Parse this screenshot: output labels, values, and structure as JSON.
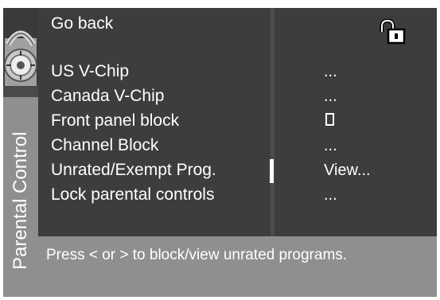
{
  "sidebar": {
    "title": "Parental Control"
  },
  "menu": {
    "go_back": "Go back",
    "items": [
      {
        "label": "US V-Chip",
        "value": "..."
      },
      {
        "label": "Canada V-Chip",
        "value": "..."
      },
      {
        "label": "Front panel block",
        "value": ""
      },
      {
        "label": "Channel Block",
        "value": "..."
      },
      {
        "label": "Unrated/Exempt Prog.",
        "value": "View..."
      },
      {
        "label": "Lock parental controls",
        "value": "..."
      }
    ],
    "selected_index": 4
  },
  "status_icon": "unlocked-padlock-icon",
  "front_panel_checkbox": {
    "checked": false
  },
  "footer": {
    "hint": "Press < or > to block/view unrated programs."
  },
  "colors": {
    "panel_dark": "#3d3d3d",
    "panel_light": "#8f8f8f",
    "text": "#ffffff"
  }
}
